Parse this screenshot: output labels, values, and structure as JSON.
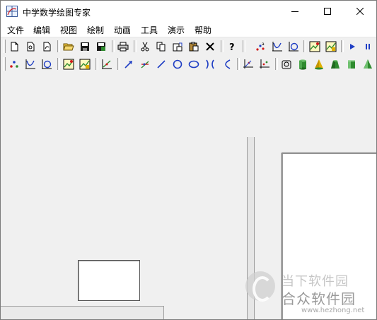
{
  "window": {
    "title": "中学数学绘图专家"
  },
  "menubar": {
    "items": [
      "文件",
      "编辑",
      "视图",
      "绘制",
      "动画",
      "工具",
      "演示",
      "帮助"
    ]
  },
  "toolbar1": {
    "icons": [
      "new-document-icon",
      "new-document-2-icon",
      "new-document-3-icon",
      "open-folder-icon",
      "save-icon",
      "save-as-icon",
      "print-icon",
      "cut-icon",
      "copy-icon",
      "paste-special-icon",
      "paste-icon",
      "delete-icon",
      "help-icon",
      "point-labels-icon",
      "function-graph-icon",
      "polar-graph-icon",
      "plot-chart-icon",
      "plot-chart-2-icon",
      "play-icon",
      "pause-icon"
    ]
  },
  "toolbar2": {
    "icons": [
      "points-icon",
      "curve-icon",
      "parametric-icon",
      "chart-yellow-icon",
      "chart-box-icon",
      "axes-function-icon",
      "arrow-icon",
      "vector-icon",
      "line-icon",
      "circle-icon",
      "ellipse-icon",
      "hyperbola-icon",
      "parabola-icon",
      "coordinate-axes-icon",
      "grid-axes-icon",
      "solid-box-icon",
      "cylinder-icon",
      "cone-icon",
      "frustum-icon",
      "prism-icon",
      "pyramid-icon"
    ]
  },
  "watermark": {
    "top": "当下软件园",
    "main": "合众软件园",
    "url": "www.hezhong.net"
  },
  "colors": {
    "icon_blue": "#1f3ec4",
    "icon_green": "#2e8b2e",
    "icon_red": "#d11a1a",
    "icon_yellow": "#e0b000"
  }
}
